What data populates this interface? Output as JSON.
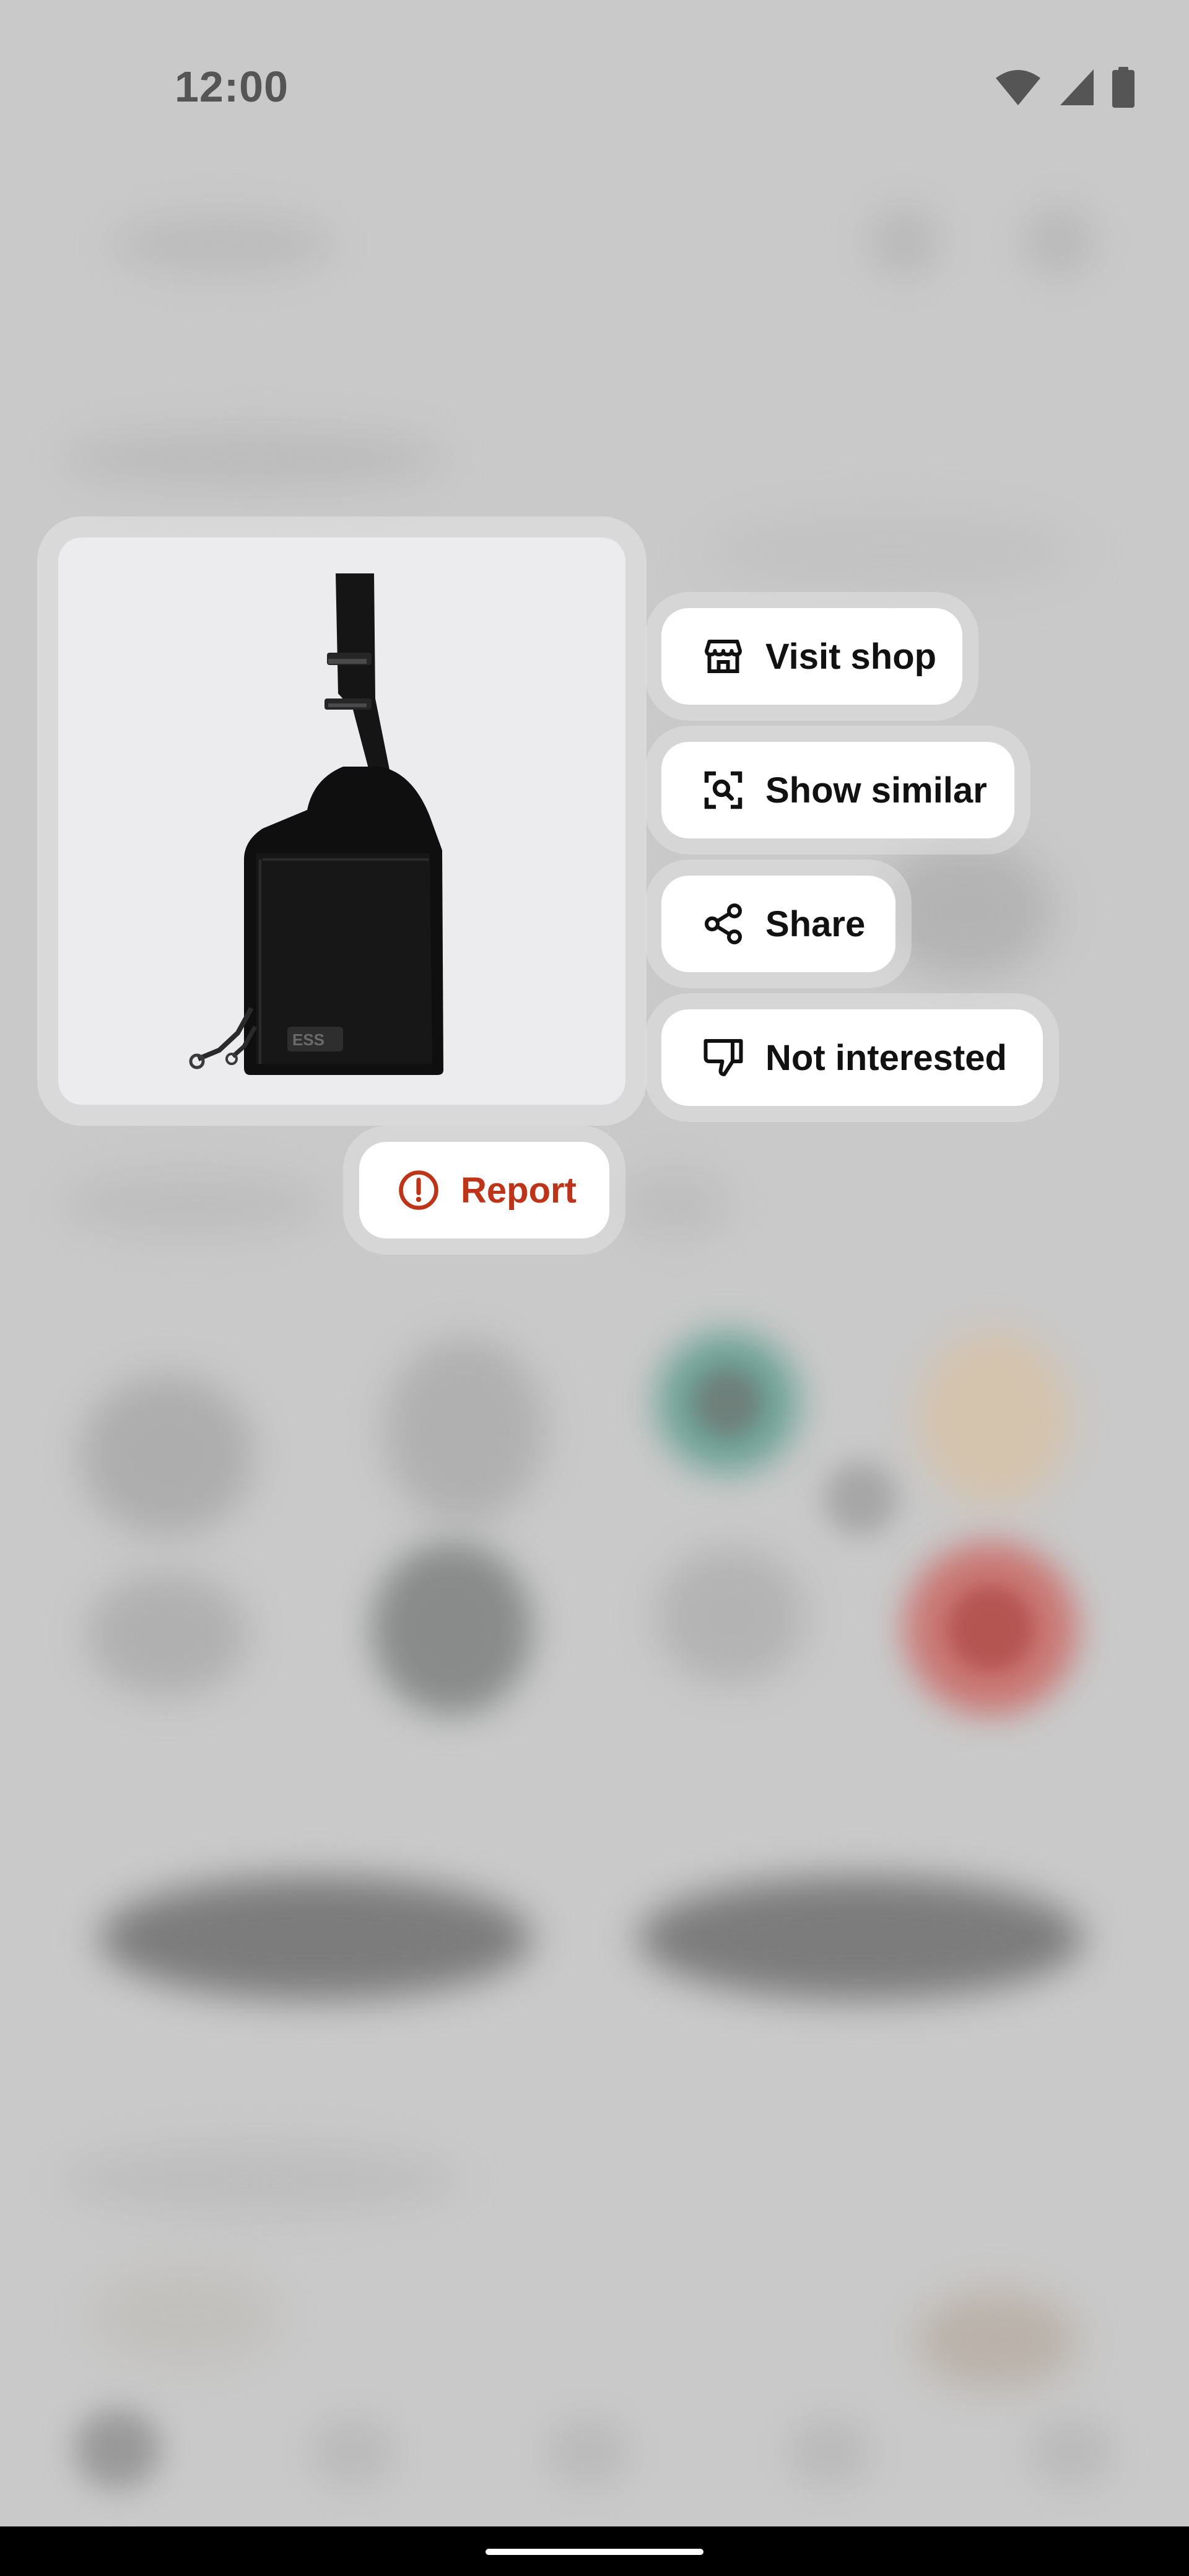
{
  "status_bar": {
    "time": "12:00",
    "icons": [
      "wifi-icon",
      "cellular-signal-icon",
      "battery-icon"
    ]
  },
  "product": {
    "image": "black-crossbody-sling-bag"
  },
  "actions": {
    "visit_shop": {
      "label": "Visit shop",
      "icon": "storefront-icon"
    },
    "show_similar": {
      "label": "Show similar",
      "icon": "visual-search-icon"
    },
    "share": {
      "label": "Share",
      "icon": "share-icon"
    },
    "not_interested": {
      "label": "Not interested",
      "icon": "thumbs-down-icon"
    },
    "report": {
      "label": "Report",
      "icon": "alert-circle-icon"
    }
  },
  "colors": {
    "overlay_background": "#c9c9c9",
    "menu_background": "#ffffff",
    "report_accent": "#bd3418",
    "text": "#111111"
  }
}
